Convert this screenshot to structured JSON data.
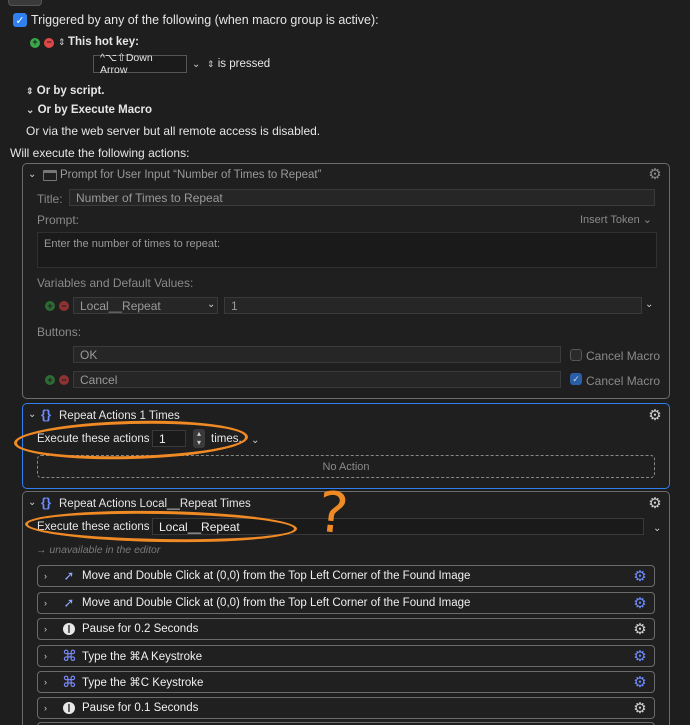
{
  "trigger": {
    "header": "Triggered by any of the following (when macro group is active):",
    "hotkey_label": "This hot key:",
    "hotkey_value": "^⌥⇧Down Arrow",
    "hotkey_state": "is pressed",
    "by_script": "Or by script.",
    "by_execute_macro": "Or by Execute Macro",
    "web_server": "Or via the web server but all remote access is disabled."
  },
  "actions_header": "Will execute the following actions:",
  "prompt_action": {
    "title": "Prompt for User Input “Number of Times to Repeat”",
    "title_label": "Title:",
    "title_value": "Number of Times to Repeat",
    "prompt_label": "Prompt:",
    "insert_token": "Insert Token",
    "prompt_value": "Enter the number of times to repeat:",
    "variables_label": "Variables and Default Values:",
    "variable_name": "Local__Repeat",
    "variable_default": "1",
    "buttons_label": "Buttons:",
    "buttons": [
      {
        "label": "OK",
        "cancel_macro": "Cancel Macro",
        "checked": false
      },
      {
        "label": "Cancel",
        "cancel_macro": "Cancel Macro",
        "checked": true
      }
    ]
  },
  "repeat1": {
    "title": "Repeat Actions 1 Times",
    "execute_label": "Execute these actions",
    "count": "1",
    "times_label": "times.",
    "no_action": "No Action"
  },
  "repeat2": {
    "title": "Repeat Actions Local__Repeat Times",
    "execute_label": "Execute these actions",
    "count_value": "Local__Repeat",
    "unavailable": "→ unavailable in the editor",
    "sub_actions": [
      {
        "label": "Move and Double Click at (0,0) from the Top Left Corner of the Found Image",
        "icon": "cursor-icon"
      },
      {
        "label": "Move and Double Click at (0,0) from the Top Left Corner of the Found Image",
        "icon": "cursor-icon"
      },
      {
        "label": "Pause for 0.2 Seconds",
        "icon": "pause-icon"
      },
      {
        "label": "Type the ⌘A Keystroke",
        "icon": "command-icon"
      },
      {
        "label": "Type the ⌘C Keystroke",
        "icon": "command-icon"
      },
      {
        "label": "Pause for 0.1 Seconds",
        "icon": "pause-icon"
      }
    ]
  },
  "annotation": {
    "question_mark": "?",
    "color": "#f08a24"
  },
  "colors": {
    "accent": "#2f7ff0",
    "background": "#1e1e1e",
    "add": "#3aa84a",
    "remove": "#e04848"
  }
}
